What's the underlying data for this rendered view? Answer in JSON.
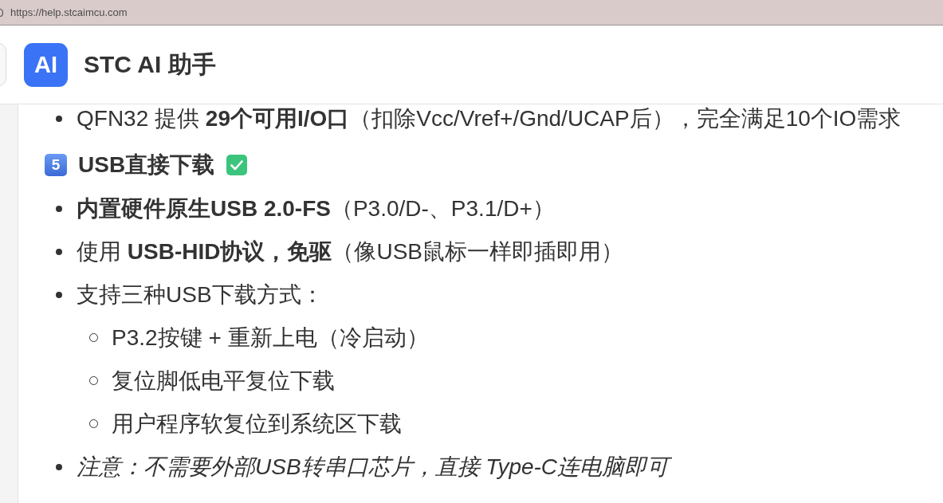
{
  "browser": {
    "url": "https://help.stcaimcu.com"
  },
  "header": {
    "logo": "AI",
    "title": "STC AI 助手"
  },
  "content": {
    "intro_items": [
      {
        "text": "QFN32 提供 **29个可用I/O口**（扣除Vcc/Vref+/Gnd/UCAP后），完全满足10个IO需求",
        "italic": false
      }
    ],
    "section": {
      "number": "5",
      "title": "USB直接下载",
      "checked": true,
      "items": [
        {
          "text": "**内置硬件原生USB 2.0-FS**（P3.0/D-、P3.1/D+）",
          "italic": false
        },
        {
          "text": "使用 **USB-HID协议，免驱**（像USB鼠标一样即插即用）",
          "italic": false
        },
        {
          "text": "支持三种USB下载方式：",
          "italic": false,
          "children": [
            {
              "text": "P3.2按键 + 重新上电（冷启动）"
            },
            {
              "text": "复位脚低电平复位下载"
            },
            {
              "text": "用户程序软复位到系统区下载"
            }
          ]
        },
        {
          "text": "注意：不需要外部USB转串口芯片，直接 Type-C连电脑即可",
          "italic": true
        }
      ]
    }
  }
}
